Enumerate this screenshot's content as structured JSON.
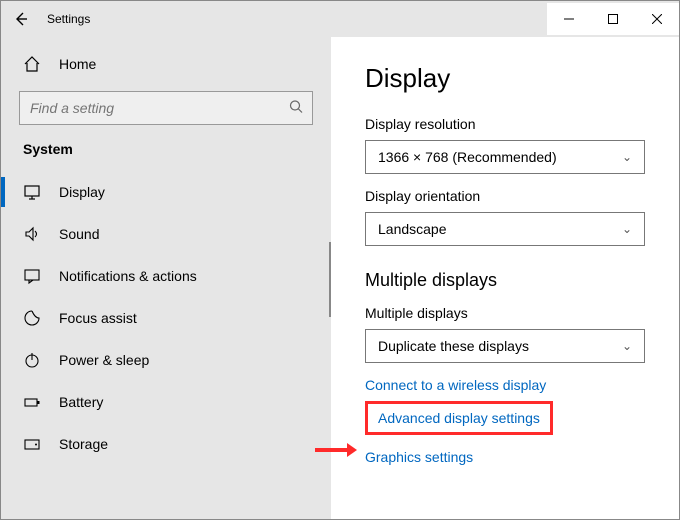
{
  "titlebar": {
    "title": "Settings",
    "back_tooltip": "Back"
  },
  "sidebar": {
    "home_label": "Home",
    "search_placeholder": "Find a setting",
    "category_label": "System",
    "items": [
      {
        "label": "Display",
        "icon": "display",
        "selected": true
      },
      {
        "label": "Sound",
        "icon": "sound",
        "selected": false
      },
      {
        "label": "Notifications & actions",
        "icon": "notifications",
        "selected": false
      },
      {
        "label": "Focus assist",
        "icon": "focus",
        "selected": false
      },
      {
        "label": "Power & sleep",
        "icon": "power",
        "selected": false
      },
      {
        "label": "Battery",
        "icon": "battery",
        "selected": false
      },
      {
        "label": "Storage",
        "icon": "storage",
        "selected": false
      }
    ]
  },
  "content": {
    "page_title": "Display",
    "resolution_label": "Display resolution",
    "resolution_value": "1366 × 768 (Recommended)",
    "orientation_label": "Display orientation",
    "orientation_value": "Landscape",
    "multiple_heading": "Multiple displays",
    "multiple_label": "Multiple displays",
    "multiple_value": "Duplicate these displays",
    "link_wireless": "Connect to a wireless display",
    "link_advanced": "Advanced display settings",
    "link_graphics": "Graphics settings"
  },
  "colors": {
    "accent": "#0067c0",
    "callout": "#ff2a2a"
  }
}
